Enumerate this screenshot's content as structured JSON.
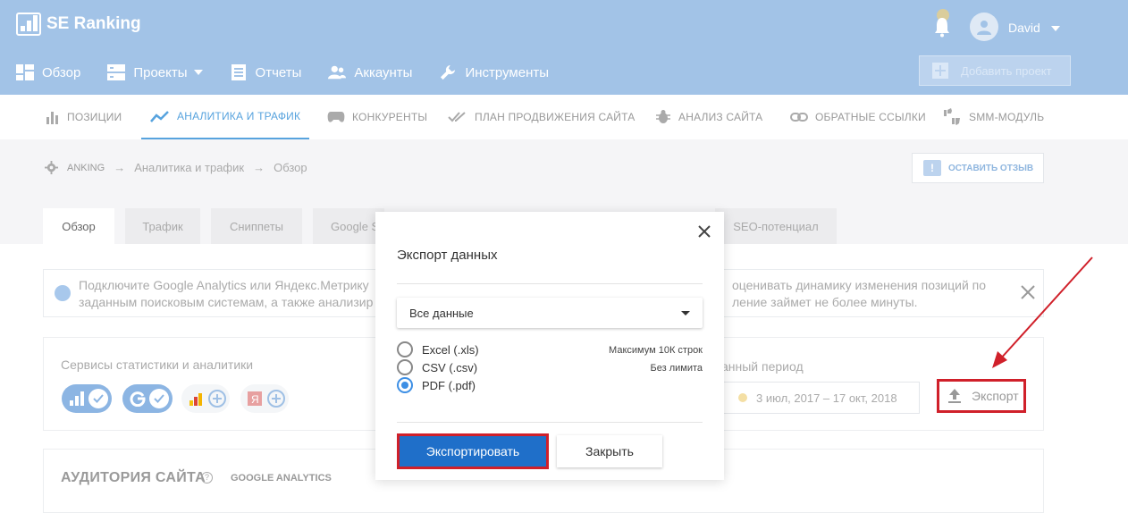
{
  "app": {
    "logo_text": "SE Ranking",
    "user_name": "David",
    "add_project": "Добавить проект"
  },
  "mainnav": [
    {
      "label": "Обзор",
      "icon": "dashboard-icon"
    },
    {
      "label": "Проекты",
      "icon": "projects-icon"
    },
    {
      "label": "Отчеты",
      "icon": "reports-icon"
    },
    {
      "label": "Аккаунты",
      "icon": "accounts-icon"
    },
    {
      "label": "Инструменты",
      "icon": "wrench-icon"
    }
  ],
  "subnav": [
    {
      "label": "ПОЗИЦИИ",
      "icon": "bar-chart-icon"
    },
    {
      "label": "АНАЛИТИКА И ТРАФИК",
      "icon": "trend-line-icon"
    },
    {
      "label": "КОНКУРЕНТЫ",
      "icon": "gamepad-icon"
    },
    {
      "label": "ПЛАН ПРОДВИЖЕНИЯ САЙТА",
      "icon": "double-check-icon"
    },
    {
      "label": "АНАЛИЗ САЙТА",
      "icon": "bug-icon"
    },
    {
      "label": "ОБРАТНЫЕ ССЫЛКИ",
      "icon": "link-icon"
    },
    {
      "label": "SMM-МОДУЛЬ",
      "icon": "thumbs-icon"
    }
  ],
  "breadcrumb": {
    "project": "ANKING",
    "section": "Аналитика и трафик",
    "page": "Обзор"
  },
  "feedback": {
    "label": "ОСТАВИТЬ ОТЗЫВ"
  },
  "content_tabs": [
    "Обзор",
    "Трафик",
    "Сниппеты",
    "Google S",
    "SEO-потенциал"
  ],
  "banner": {
    "left_line1": "Подключите Google Analytics или Яндекс.Метрику",
    "left_line2": "заданным поисковым системам, а также анализир",
    "right_line1": "оценивать динамику изменения позиций по",
    "right_line2": "ление займет не более минуты."
  },
  "analytics": {
    "title": "Сервисы статистики и аналитики",
    "period_label": "анный период",
    "period_value": "3 июл, 2017 – 17 окт, 2018",
    "export_label": "Экспорт"
  },
  "audience": {
    "title": "АУДИТОРИЯ САЙТА",
    "source": "GOOGLE ANALYTICS",
    "help": "?"
  },
  "modal": {
    "title": "Экспорт данных",
    "select_value": "Все данные",
    "options": [
      {
        "label": "Excel (.xls)",
        "note": "Максимум 10К строк",
        "selected": false
      },
      {
        "label": "CSV (.csv)",
        "note": "Без лимита",
        "selected": false
      },
      {
        "label": "PDF (.pdf)",
        "note": "",
        "selected": true
      }
    ],
    "export_button": "Экспортировать",
    "close_button": "Закрыть"
  },
  "colors": {
    "header": "#a2c3e7",
    "accent": "#57a3de",
    "highlight": "#d0202a",
    "primary_button": "#1f6fc9"
  }
}
